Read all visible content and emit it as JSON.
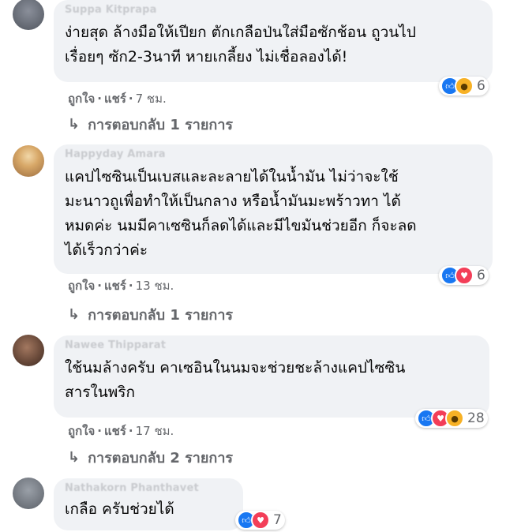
{
  "comments": [
    {
      "author": "Suppa Kitprapa",
      "lines": [
        "ง่ายสุด ล้างมือให้เปียก ตักเกลือป่นใส่มือซักช้อน ถูวนไป",
        "เรื่อยๆ ซัก2-3นาที หายเกลี้ยง ไม่เชื่อลองได้!"
      ],
      "reactions": [
        "like",
        "wow"
      ],
      "reaction_count": "6",
      "like": "ถูกใจ",
      "share": "แชร์",
      "time": "7 ชม.",
      "replies": "การตอบกลับ 1 รายการ"
    },
    {
      "author": "Happyday Amara",
      "lines": [
        "แคปไซซินเป็นเบสและละลายได้ในน้ำมัน ไม่ว่าจะใช้",
        "มะนาวถูเพื่อทำให้เป็นกลาง หรือน้ำมันมะพร้าวทา ได้",
        "หมดค่ะ นมมีคาเซซินก็ลดได้และมีไขมันช่วยอีก ก็จะลด",
        "ได้เร็วกว่าค่ะ"
      ],
      "reactions": [
        "like",
        "love"
      ],
      "reaction_count": "6",
      "like": "ถูกใจ",
      "share": "แชร์",
      "time": "13 ชม.",
      "replies": "การตอบกลับ 1 รายการ"
    },
    {
      "author": "Nawee Thipparat",
      "lines": [
        "ใช้นมล้างครับ คาเซอินในนมจะช่วยชะล้างแคปไซซิน",
        "สารในพริก"
      ],
      "reactions": [
        "like",
        "love",
        "wow"
      ],
      "reaction_count": "28",
      "like": "ถูกใจ",
      "share": "แชร์",
      "time": "17 ชม.",
      "replies": "การตอบกลับ 2 รายการ"
    },
    {
      "author": "Nathakorn Phanthavet",
      "lines": [
        "เกลือ ครับช่วยได้"
      ],
      "reactions": [
        "like",
        "love"
      ],
      "reaction_count": "7"
    }
  ],
  "colors": {
    "bubble": "#f0f2f5",
    "secondary_text": "#65676b",
    "like_blue": "#1877f2",
    "love_red": "#f33e58",
    "wow_yellow": "#f7b125"
  }
}
